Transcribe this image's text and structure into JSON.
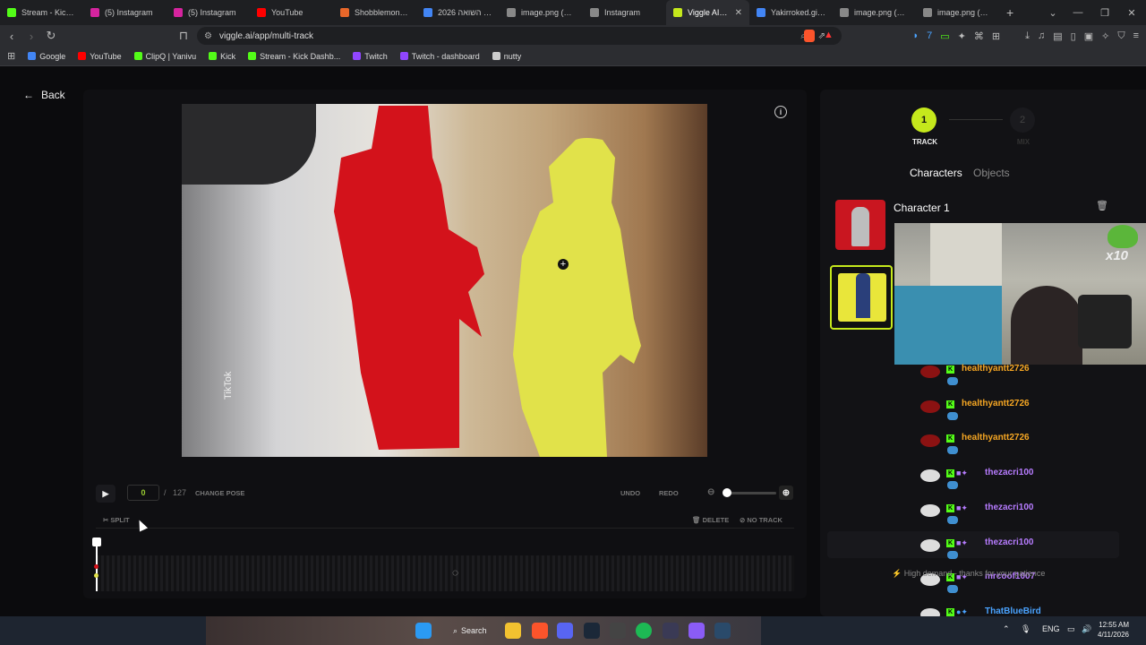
{
  "browser": {
    "tabs": [
      {
        "label": "Stream - Kick Da",
        "color": "#53fc18"
      },
      {
        "label": "(5) Instagram",
        "color": "#d6249f"
      },
      {
        "label": "(5) Instagram",
        "color": "#d6249f"
      },
      {
        "label": "YouTube",
        "color": "#ff0000"
      },
      {
        "label": "Shobblemon - M",
        "color": "#e8672a"
      },
      {
        "label": "יום השואה 2026",
        "color": "#4285f4"
      },
      {
        "label": "image.png (473×",
        "color": "#888888"
      },
      {
        "label": "Instagram",
        "color": "#888888"
      },
      {
        "label": "Viggle AI - F",
        "color": "#c5e81c",
        "active": true
      },
      {
        "label": "Yakirroked.gif - (",
        "color": "#4285f4"
      },
      {
        "label": "image.png (877×",
        "color": "#888888"
      },
      {
        "label": "image.png (1024",
        "color": "#888888"
      }
    ],
    "new_tab": "+",
    "url": "viggle.ai/app/multi-track",
    "bookmarks": [
      {
        "label": "Google",
        "color": "#4285f4"
      },
      {
        "label": "YouTube",
        "color": "#ff0000"
      },
      {
        "label": "ClipQ | Yanivu",
        "color": "#53fc18"
      },
      {
        "label": "Kick",
        "color": "#53fc18"
      },
      {
        "label": "Stream - Kick Dashb...",
        "color": "#53fc18"
      },
      {
        "label": "Twitch",
        "color": "#9146ff"
      },
      {
        "label": "Twitch - dashboard",
        "color": "#9146ff"
      },
      {
        "label": "nutty",
        "color": "#cccccc"
      }
    ]
  },
  "app": {
    "back_label": "Back",
    "frame_current": "0",
    "frame_separator": "/",
    "frame_total": "127",
    "change_pose": "CHANGE POSE",
    "undo": "UNDO",
    "redo": "REDO",
    "split": "SPLIT",
    "delete": "DELETE",
    "no_track": "NO TRACK",
    "steps": [
      {
        "number": "1",
        "label": "TRACK"
      },
      {
        "number": "2",
        "label": "MIX"
      }
    ],
    "tabs": {
      "characters": "Characters",
      "objects": "Objects"
    },
    "character1_name": "Character 1",
    "video_watermark": "TikTok",
    "accent": "#c5e81c"
  },
  "webcam": {
    "multiplier": "x10"
  },
  "chat": {
    "messages": [
      {
        "user": "healthyantt2726",
        "color": "#f5a623",
        "extra": ""
      },
      {
        "user": "healthyantt2726",
        "color": "#f5a623",
        "extra": ""
      },
      {
        "user": "healthyantt2726",
        "color": "#f5a623",
        "extra": ""
      },
      {
        "user": "thezacri100",
        "color": "#b77cff",
        "extra": "■✦"
      },
      {
        "user": "thezacri100",
        "color": "#b77cff",
        "extra": "■✦"
      },
      {
        "user": "thezacri100",
        "color": "#b77cff",
        "extra": "■✦"
      },
      {
        "user": "mrcoof1007",
        "color": "#b77cff",
        "extra": "■✦"
      },
      {
        "user": "ThatBlueBird",
        "color": "#4aa3ff",
        "extra": "●✦"
      }
    ],
    "notice": "High demand - thanks for your patience"
  },
  "taskbar": {
    "search": "Search",
    "lang": "ENG",
    "time": "12:55 AM",
    "date": "4/11/2026"
  }
}
